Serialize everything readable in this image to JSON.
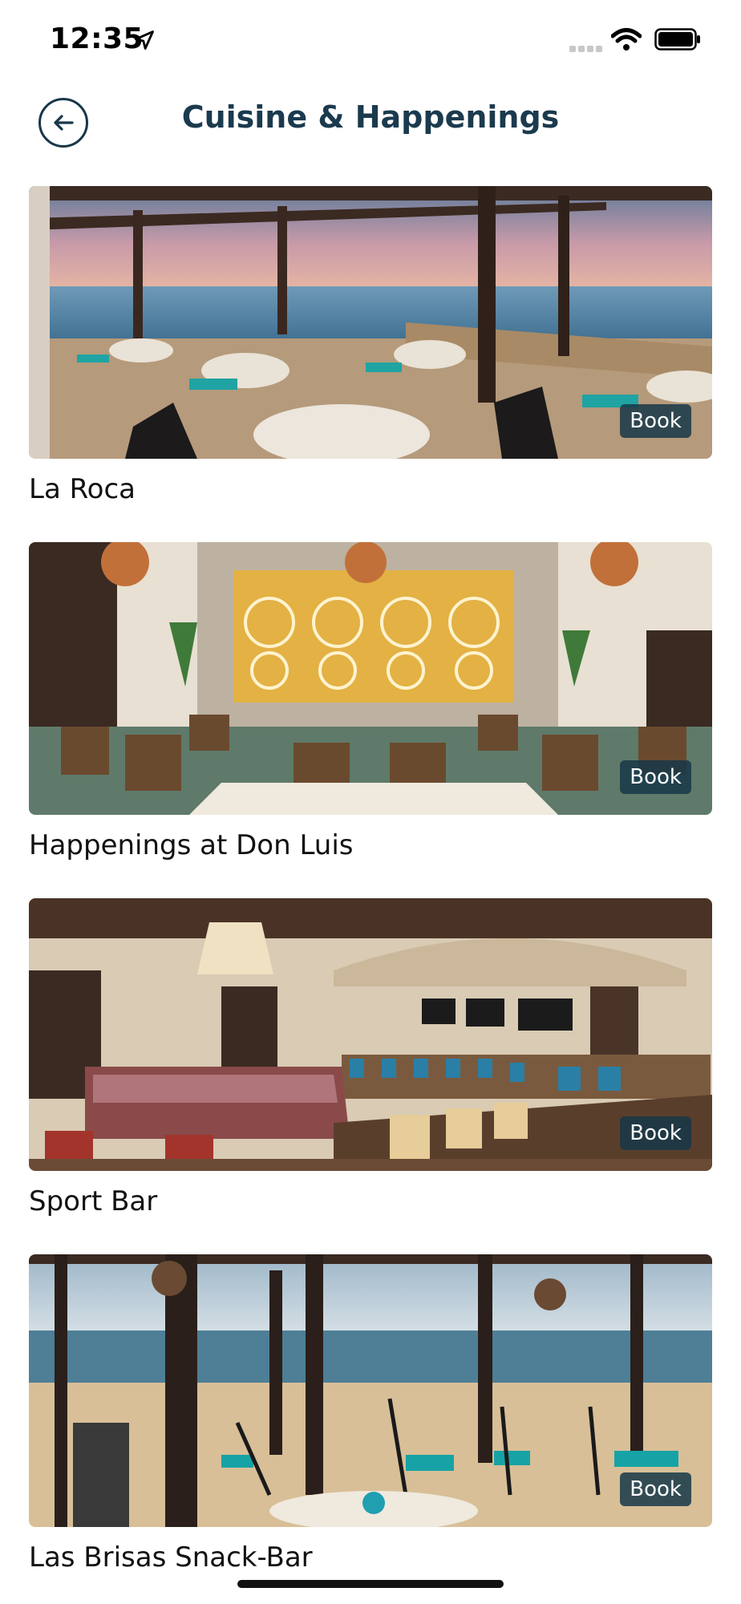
{
  "status_bar": {
    "time": "12:35"
  },
  "header": {
    "title": "Cuisine & Happenings"
  },
  "venues": [
    {
      "name": "La Roca",
      "book_label": "Book"
    },
    {
      "name": "Happenings at Don Luis",
      "book_label": "Book"
    },
    {
      "name": "Sport Bar",
      "book_label": "Book"
    },
    {
      "name": "Las Brisas Snack-Bar",
      "book_label": "Book"
    }
  ]
}
